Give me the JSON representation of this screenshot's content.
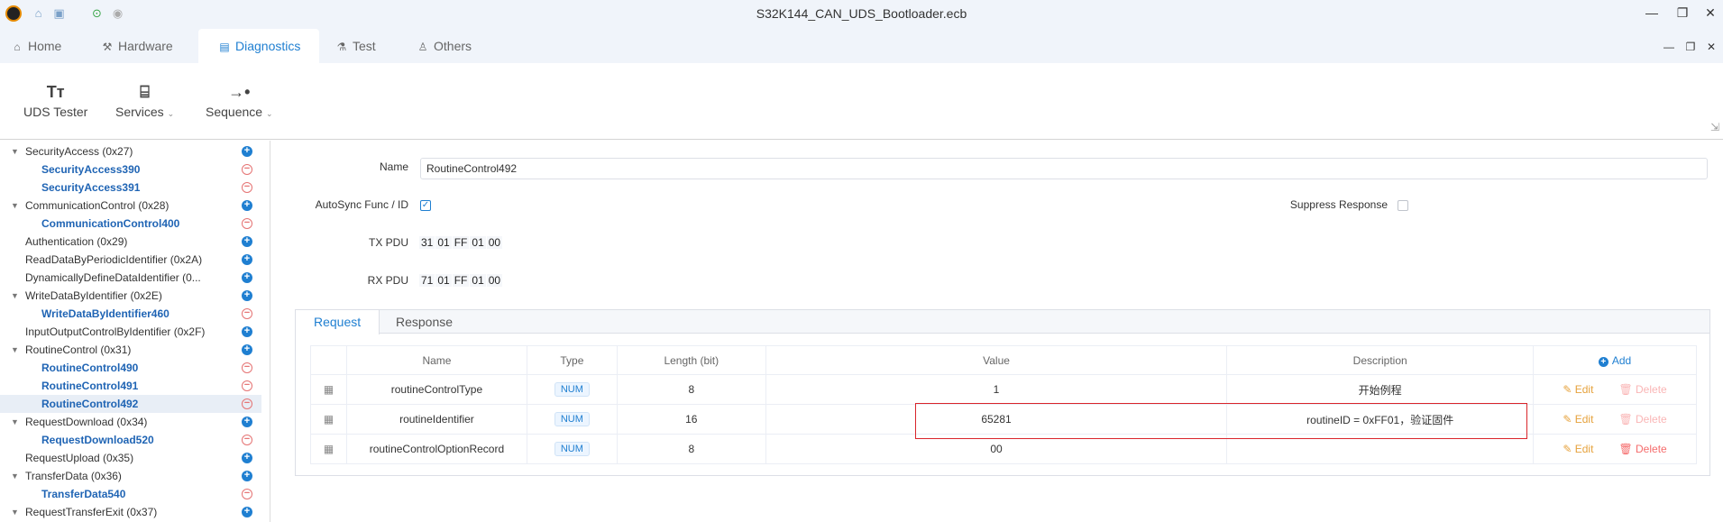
{
  "window": {
    "title": "S32K144_CAN_UDS_Bootloader.ecb",
    "controls": [
      "—",
      "❐",
      "✕"
    ],
    "sub_controls": [
      "—",
      "❐",
      "✕"
    ]
  },
  "tabs": [
    {
      "label": "Home",
      "icon": "home-icon",
      "glyph": "⌂"
    },
    {
      "label": "Hardware",
      "icon": "hammer-icon",
      "glyph": "⚒"
    },
    {
      "label": "Diagnostics",
      "icon": "document-icon",
      "glyph": "▤"
    },
    {
      "label": "Test",
      "icon": "flask-icon",
      "glyph": "⚗"
    },
    {
      "label": "Others",
      "icon": "user-icon",
      "glyph": "♙"
    }
  ],
  "active_tab": "Diagnostics",
  "ribbon": {
    "uds_tester": "UDS Tester",
    "services": "Services",
    "sequence": "Sequence"
  },
  "sidebar": {
    "items": [
      {
        "label": "SecurityAccess (0x27)",
        "type": "parent",
        "expanded": true
      },
      {
        "label": "SecurityAccess390",
        "type": "child"
      },
      {
        "label": "SecurityAccess391",
        "type": "child"
      },
      {
        "label": "CommunicationControl (0x28)",
        "type": "parent",
        "expanded": true
      },
      {
        "label": "CommunicationControl400",
        "type": "child"
      },
      {
        "label": "Authentication (0x29)",
        "type": "parent",
        "expanded": false
      },
      {
        "label": "ReadDataByPeriodicIdentifier (0x2A)",
        "type": "parent",
        "expanded": false
      },
      {
        "label": "DynamicallyDefineDataIdentifier (0...",
        "type": "parent",
        "expanded": false
      },
      {
        "label": "WriteDataByIdentifier (0x2E)",
        "type": "parent",
        "expanded": true
      },
      {
        "label": "WriteDataByIdentifier460",
        "type": "child"
      },
      {
        "label": "InputOutputControlByIdentifier (0x2F)",
        "type": "parent",
        "expanded": false
      },
      {
        "label": "RoutineControl (0x31)",
        "type": "parent",
        "expanded": true
      },
      {
        "label": "RoutineControl490",
        "type": "child"
      },
      {
        "label": "RoutineControl491",
        "type": "child"
      },
      {
        "label": "RoutineControl492",
        "type": "child",
        "selected": true
      },
      {
        "label": "RequestDownload (0x34)",
        "type": "parent",
        "expanded": true
      },
      {
        "label": "RequestDownload520",
        "type": "child"
      },
      {
        "label": "RequestUpload (0x35)",
        "type": "parent",
        "expanded": false
      },
      {
        "label": "TransferData (0x36)",
        "type": "parent",
        "expanded": true
      },
      {
        "label": "TransferData540",
        "type": "child"
      },
      {
        "label": "RequestTransferExit (0x37)",
        "type": "parent",
        "expanded": true
      }
    ]
  },
  "form": {
    "name_label": "Name",
    "name_value": "RoutineControl492",
    "autosync_label": "AutoSync Func / ID",
    "autosync_checked": true,
    "suppress_label": "Suppress Response",
    "suppress_checked": false,
    "tx_label": "TX PDU",
    "tx_bytes": [
      "31",
      "01",
      "FF",
      "01",
      "00"
    ],
    "rx_label": "RX PDU",
    "rx_bytes": [
      "71",
      "01",
      "FF",
      "01",
      "00"
    ]
  },
  "panel": {
    "tabs": [
      "Request",
      "Response"
    ],
    "active": "Request",
    "columns": [
      "Name",
      "Type",
      "Length (bit)",
      "Value",
      "Description"
    ],
    "add_label": "Add",
    "edit_label": "Edit",
    "delete_label": "Delete",
    "rows": [
      {
        "name": "routineControlType",
        "type": "NUM",
        "length": "8",
        "value": "1",
        "description": "开始例程",
        "delete_enabled": false
      },
      {
        "name": "routineIdentifier",
        "type": "NUM",
        "length": "16",
        "value": "65281",
        "description": "routineID = 0xFF01，验证固件",
        "delete_enabled": false
      },
      {
        "name": "routineControlOptionRecord",
        "type": "NUM",
        "length": "8",
        "value": "00",
        "description": "",
        "delete_enabled": true
      }
    ]
  },
  "colors": {
    "accent": "#1f7fd1",
    "highlight_border": "#d9252b",
    "edit": "#e6a23c",
    "delete": "#f56c6c"
  }
}
